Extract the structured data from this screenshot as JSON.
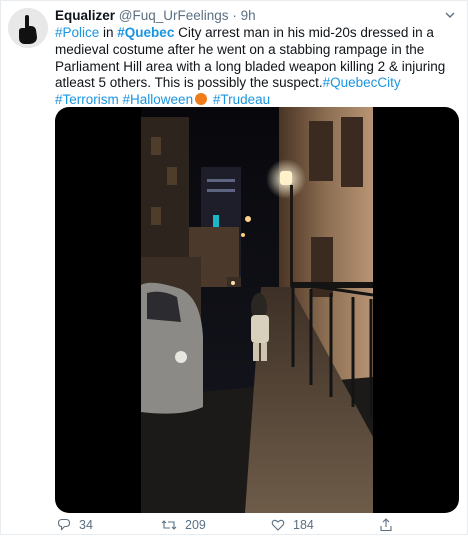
{
  "user": {
    "name": "Equalizer",
    "handle": "@Fuq_UrFeelings",
    "separator": "·",
    "time": "9h"
  },
  "tweet": {
    "segments": [
      {
        "text": "#Police",
        "type": "tag"
      },
      {
        "text": " in ",
        "type": "plain"
      },
      {
        "text": "#Quebec",
        "type": "tagbold"
      },
      {
        "text": " City arrest man in his mid-20s dressed in a medieval costume after he went on a stabbing rampage in the Parliament Hill area with a long bladed weapon killing 2 & injuring atleast 5 others. This is possibly the suspect.",
        "type": "plain"
      },
      {
        "text": "#QuebecCity",
        "type": "tag"
      },
      {
        "text": " ",
        "type": "plain"
      },
      {
        "text": "#Terrorism",
        "type": "tag"
      },
      {
        "text": " ",
        "type": "plain"
      },
      {
        "text": "#Halloween",
        "type": "tag"
      },
      {
        "text": "pumpkin-emoji",
        "type": "emoji"
      },
      {
        "text": " ",
        "type": "plain"
      },
      {
        "text": "#Trudeau",
        "type": "tag"
      }
    ]
  },
  "actions": {
    "replies": "34",
    "retweets": "209",
    "likes": "184"
  },
  "icons": {
    "reply": "reply-icon",
    "retweet": "retweet-icon",
    "like": "heart-icon",
    "share": "share-icon",
    "more": "chevron-down-icon"
  },
  "colors": {
    "link": "#1b95e0",
    "muted": "#5b7083",
    "text": "#0f1419"
  }
}
